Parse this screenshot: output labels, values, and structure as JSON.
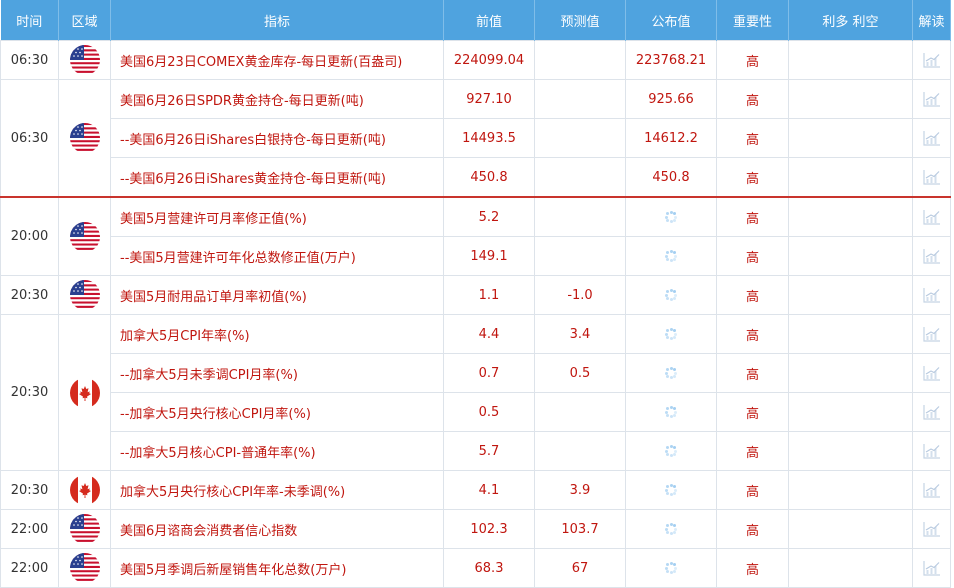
{
  "headers": [
    "时间",
    "区域",
    "指标",
    "前值",
    "预测值",
    "公布值",
    "重要性",
    "利多 利空",
    "解读"
  ],
  "groups": [
    {
      "time": "06:30",
      "flag": "us",
      "rows": [
        {
          "indicator": "美国6月23日COMEX黄金库存-每日更新(百盎司)",
          "prev": "224099.04",
          "forecast": "",
          "actual": "223768.21",
          "importance": "高",
          "pending": false
        }
      ]
    },
    {
      "time": "06:30",
      "flag": "us",
      "rows": [
        {
          "indicator": "美国6月26日SPDR黄金持仓-每日更新(吨)",
          "prev": "927.10",
          "forecast": "",
          "actual": "925.66",
          "importance": "高",
          "pending": false
        },
        {
          "indicator": "--美国6月26日iShares白银持仓-每日更新(吨)",
          "prev": "14493.5",
          "forecast": "",
          "actual": "14612.2",
          "importance": "高",
          "pending": false
        },
        {
          "indicator": "--美国6月26日iShares黄金持仓-每日更新(吨)",
          "prev": "450.8",
          "forecast": "",
          "actual": "450.8",
          "importance": "高",
          "pending": false
        }
      ]
    },
    {
      "time": "20:00",
      "flag": "us",
      "separator": true,
      "rows": [
        {
          "indicator": "美国5月营建许可月率修正值(%)",
          "prev": "5.2",
          "forecast": "",
          "actual": "",
          "importance": "高",
          "pending": true
        },
        {
          "indicator": "--美国5月营建许可年化总数修正值(万户)",
          "prev": "149.1",
          "forecast": "",
          "actual": "",
          "importance": "高",
          "pending": true
        }
      ]
    },
    {
      "time": "20:30",
      "flag": "us",
      "rows": [
        {
          "indicator": "美国5月耐用品订单月率初值(%)",
          "prev": "1.1",
          "forecast": "-1.0",
          "actual": "",
          "importance": "高",
          "pending": true
        }
      ]
    },
    {
      "time": "20:30",
      "flag": "ca",
      "rows": [
        {
          "indicator": "加拿大5月CPI年率(%)",
          "prev": "4.4",
          "forecast": "3.4",
          "actual": "",
          "importance": "高",
          "pending": true
        },
        {
          "indicator": "--加拿大5月未季调CPI月率(%)",
          "prev": "0.7",
          "forecast": "0.5",
          "actual": "",
          "importance": "高",
          "pending": true
        },
        {
          "indicator": "--加拿大5月央行核心CPI月率(%)",
          "prev": "0.5",
          "forecast": "",
          "actual": "",
          "importance": "高",
          "pending": true
        },
        {
          "indicator": "--加拿大5月核心CPI-普通年率(%)",
          "prev": "5.7",
          "forecast": "",
          "actual": "",
          "importance": "高",
          "pending": true
        }
      ]
    },
    {
      "time": "20:30",
      "flag": "ca",
      "rows": [
        {
          "indicator": "加拿大5月央行核心CPI年率-未季调(%)",
          "prev": "4.1",
          "forecast": "3.9",
          "actual": "",
          "importance": "高",
          "pending": true
        }
      ]
    },
    {
      "time": "22:00",
      "flag": "us",
      "rows": [
        {
          "indicator": "美国6月谘商会消费者信心指数",
          "prev": "102.3",
          "forecast": "103.7",
          "actual": "",
          "importance": "高",
          "pending": true
        }
      ]
    },
    {
      "time": "22:00",
      "flag": "us",
      "rows": [
        {
          "indicator": "美国5月季调后新屋销售年化总数(万户)",
          "prev": "68.3",
          "forecast": "67",
          "actual": "",
          "importance": "高",
          "pending": true
        }
      ]
    }
  ],
  "colors": {
    "header": "#4fa3df",
    "value": "#c0160f",
    "separator": "#c9342d"
  },
  "icons": {
    "us": "us-flag-icon",
    "ca": "canada-flag-icon",
    "pending": "loading-spinner-icon",
    "interpret": "chart-icon"
  }
}
